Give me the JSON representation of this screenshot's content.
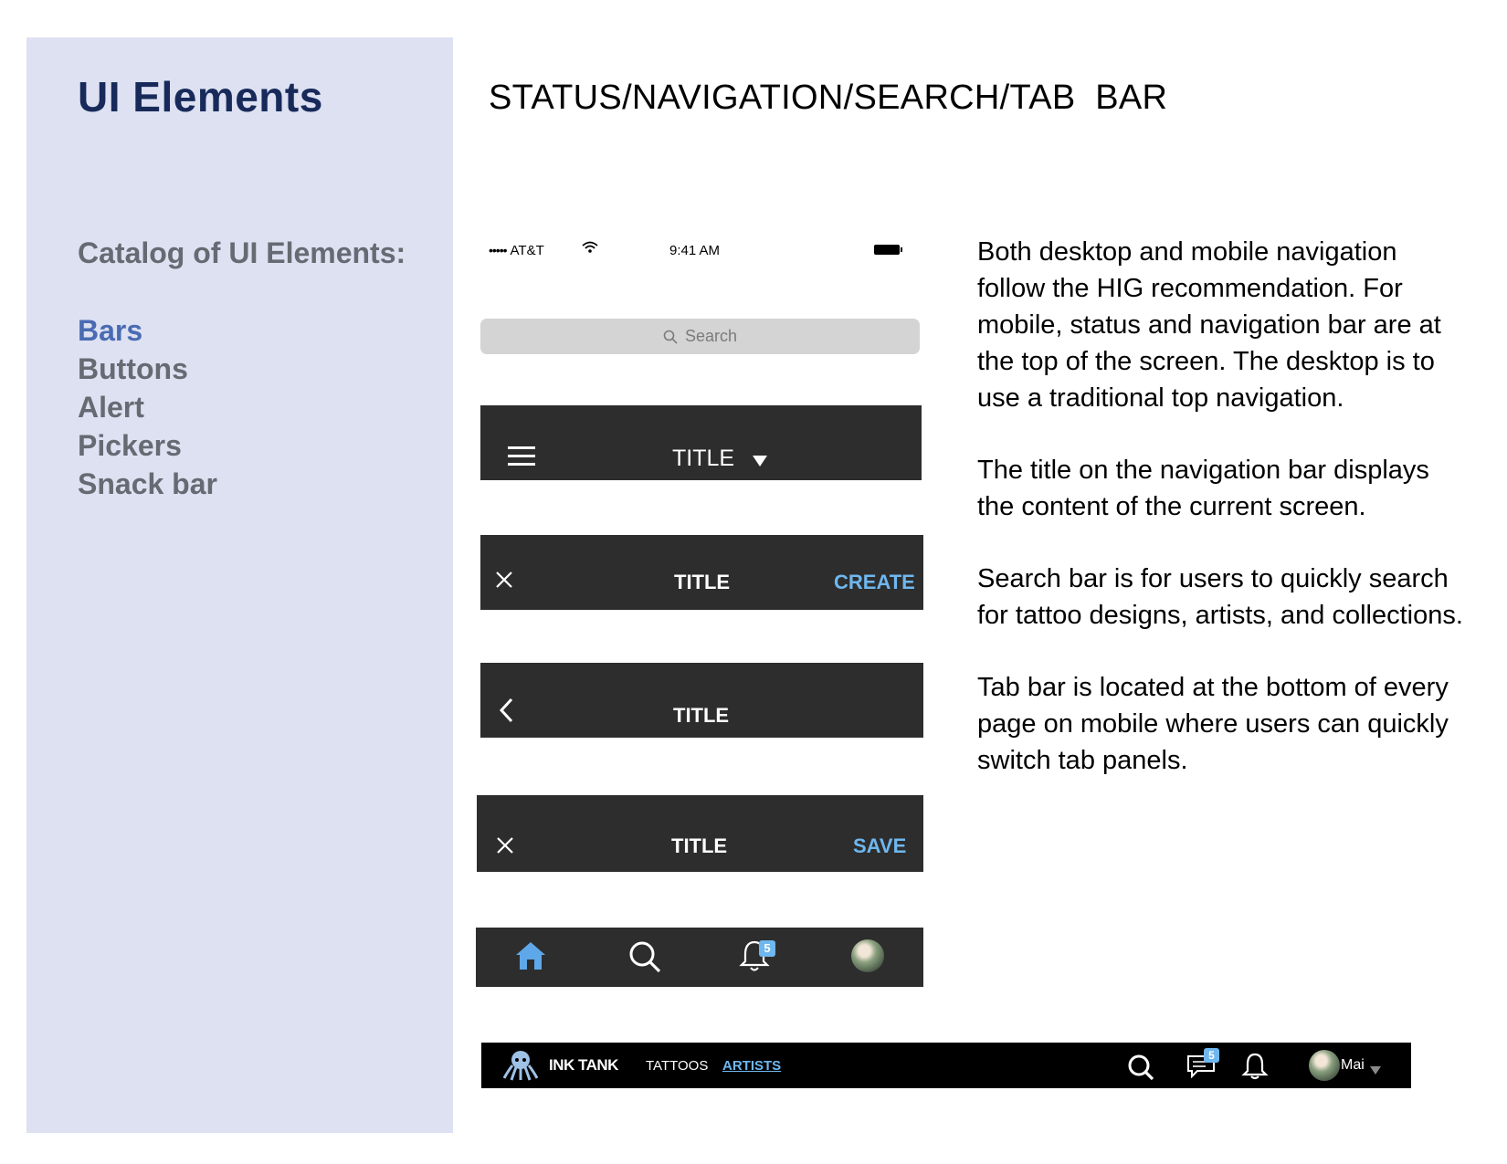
{
  "sidebar": {
    "title": "UI Elements",
    "catalog_heading": "Catalog of UI Elements:",
    "items": [
      {
        "label": "Bars",
        "active": true
      },
      {
        "label": "Buttons",
        "active": false
      },
      {
        "label": "Alert",
        "active": false
      },
      {
        "label": "Pickers",
        "active": false
      },
      {
        "label": "Snack bar",
        "active": false
      }
    ]
  },
  "main": {
    "title": "STATUS/NAVIGATION/SEARCH/TAB  BAR"
  },
  "status_bar": {
    "signal": "•••••",
    "carrier": "AT&T",
    "time": "9:41 AM",
    "icons": [
      "wifi-icon",
      "battery-icon"
    ]
  },
  "search_bar": {
    "placeholder": "Search",
    "icon": "search-icon"
  },
  "nav_bars": [
    {
      "left_icon": "menu-icon",
      "title": "TITLE",
      "title_icon": "caret-down-icon",
      "action": ""
    },
    {
      "left_icon": "close-icon",
      "title": "TITLE",
      "action": "CREATE"
    },
    {
      "left_icon": "back-chevron-icon",
      "title": "TITLE",
      "action": ""
    },
    {
      "left_icon": "close-icon",
      "title": "TITLE",
      "action": "SAVE"
    }
  ],
  "tab_bar": {
    "tabs": [
      "home-icon",
      "search-icon",
      "bell-icon",
      "avatar"
    ],
    "notification_badge": "5"
  },
  "desktop_nav": {
    "brand": "INK TANK",
    "logo_icon": "octopus-logo-icon",
    "links": [
      {
        "label": "TATTOOS",
        "active": false
      },
      {
        "label": "ARTISTS",
        "active": true
      }
    ],
    "message_badge": "5",
    "user_name": "Mai",
    "icons": [
      "search-icon",
      "chat-icon",
      "bell-icon",
      "avatar",
      "caret-down-icon"
    ]
  },
  "description": [
    "Both desktop and mobile navigation follow the HIG recommendation. For mobile, status and navigation bar are at the top of the screen. The desktop is to use a traditional top navigation.",
    "The title on the navigation bar displays the content of the current screen.",
    "Search bar is for users to quickly search for tattoo designs, artists, and collections.",
    "Tab bar is located at the bottom of every page on mobile where users can quickly switch tab panels."
  ],
  "colors": {
    "sidebar_bg": "#dde1f2",
    "sidebar_title": "#172a5a",
    "active_item": "#4a6bb2",
    "bar_bg": "#2d2d2d",
    "accent": "#6fb7ef"
  }
}
